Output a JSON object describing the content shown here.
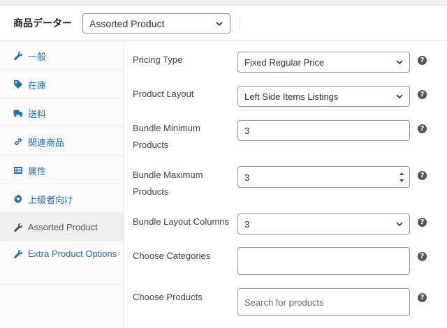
{
  "header": {
    "title": "商品データー",
    "product_type_selected": "Assorted Product"
  },
  "sidebar": {
    "items": [
      {
        "label": "一般",
        "icon": "wrench-icon"
      },
      {
        "label": "在庫",
        "icon": "tag-icon"
      },
      {
        "label": "送料",
        "icon": "truck-icon"
      },
      {
        "label": "関連商品",
        "icon": "link-icon"
      },
      {
        "label": "属性",
        "icon": "list-icon"
      },
      {
        "label": "上級者向け",
        "icon": "gear-icon"
      },
      {
        "label": "Assorted Product",
        "icon": "wrench-icon",
        "active": true
      },
      {
        "label": "Extra Product Options",
        "icon": "wrench-icon"
      }
    ]
  },
  "form": {
    "pricing_type": {
      "label": "Pricing Type",
      "value": "Fixed Regular Price"
    },
    "product_layout": {
      "label": "Product Layout",
      "value": "Left Side Items Listings"
    },
    "bundle_min": {
      "label": "Bundle Minimum Products",
      "value": "3"
    },
    "bundle_max": {
      "label": "Bundle Maximum Products",
      "value": "3"
    },
    "bundle_columns": {
      "label": "Bundle Layout Columns",
      "value": "3"
    },
    "categories": {
      "label": "Choose Categories",
      "value": ""
    },
    "products": {
      "label": "Choose Products",
      "placeholder": "Search for products"
    },
    "help_glyph": "?"
  },
  "colors": {
    "link": "#2271b1",
    "text": "#3c434a",
    "border": "#8c8f94",
    "active_tab_bg": "#eeeeee"
  }
}
